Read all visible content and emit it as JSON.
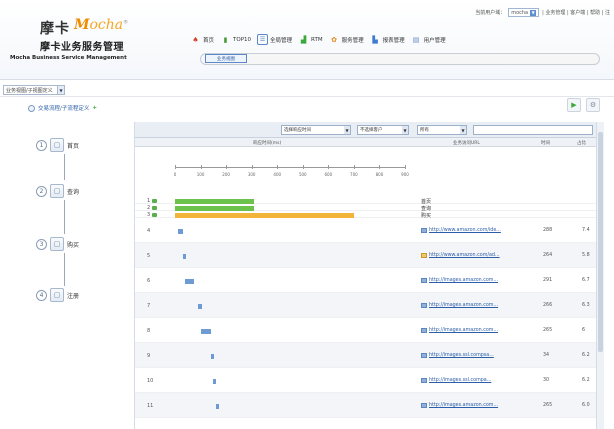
{
  "brand": {
    "name_cn": "摩卡",
    "name_en_first": "M",
    "name_en_rest": "ocha",
    "registered": "®",
    "product_cn": "摩卡业务服务管理",
    "product_en": "Mocha Business Service Management"
  },
  "toplinks": {
    "welcome": "当前用户域：",
    "user": "mocha",
    "links": "| 业务管理 | 客户端 | 帮助 | 注"
  },
  "nav": {
    "items": [
      {
        "label": "首页",
        "icon": "home-icon"
      },
      {
        "label": "TOP10",
        "icon": "top10-icon"
      },
      {
        "label": "全局管理",
        "icon": "global-icon"
      },
      {
        "label": "RTM",
        "icon": "rtm-icon"
      },
      {
        "label": "服务管理",
        "icon": "service-icon"
      },
      {
        "label": "报表管理",
        "icon": "report-icon"
      },
      {
        "label": "用户管理",
        "icon": "user-icon"
      }
    ],
    "active_tab": "业务视图"
  },
  "breadcrumb": {
    "select_value": "业务视图/子视图定义"
  },
  "subtitle": {
    "text": "交易流程/子流程定义",
    "plus": "+"
  },
  "flow": {
    "steps": [
      {
        "num": "1",
        "label": "首页"
      },
      {
        "num": "2",
        "label": "查询"
      },
      {
        "num": "3",
        "label": "购买"
      },
      {
        "num": "4",
        "label": "注册"
      }
    ]
  },
  "toolbar": {
    "select1": "选择响应时间",
    "select2": "不选择客户",
    "select3": "所有"
  },
  "columns": {
    "c1": "响应时间(ms)",
    "c2": "业务访问URL",
    "c3": "时间",
    "c4": "占比"
  },
  "axis": {
    "ticks": [
      "0",
      "100",
      "200",
      "300",
      "400",
      "500",
      "600",
      "700",
      "800",
      "900"
    ]
  },
  "rows": [
    {
      "num": "1",
      "label": "首页",
      "bar": {
        "type": "green",
        "start": 0,
        "end": 310
      }
    },
    {
      "num": "2",
      "label": "查询",
      "bar": {
        "type": "green",
        "start": 0,
        "end": 310
      }
    },
    {
      "num": "3",
      "label": "购买",
      "bar": {
        "type": "orange",
        "start": 0,
        "end": 700
      }
    },
    {
      "num": "4",
      "url": "http://www.amazon.com/ide...",
      "v1": "288",
      "v2": "7.4",
      "warn": false,
      "bar": {
        "type": "blue",
        "start": 10,
        "end": 30
      }
    },
    {
      "num": "5",
      "url": "http://www.amazon.com/ad...",
      "v1": "264",
      "v2": "5.8",
      "warn": true,
      "bar": {
        "type": "blue",
        "start": 30,
        "end": 45
      }
    },
    {
      "num": "6",
      "url": "http://images.amazon.com...",
      "v1": "291",
      "v2": "6.7",
      "warn": false,
      "bar": {
        "type": "blue",
        "start": 40,
        "end": 75
      }
    },
    {
      "num": "7",
      "url": "http://images.amazon.com...",
      "v1": "266",
      "v2": "6.3",
      "warn": false,
      "bar": {
        "type": "blue",
        "start": 90,
        "end": 105
      }
    },
    {
      "num": "8",
      "url": "http://images.amazon.com...",
      "v1": "265",
      "v2": "6",
      "warn": false,
      "bar": {
        "type": "blue",
        "start": 100,
        "end": 140
      }
    },
    {
      "num": "9",
      "url": "http://images.ssl.compsa...",
      "v1": "34",
      "v2": "6.2",
      "warn": false,
      "bar": {
        "type": "blue",
        "start": 140,
        "end": 145
      }
    },
    {
      "num": "10",
      "url": "http://images.ssl.compa...",
      "v1": "30",
      "v2": "6.2",
      "warn": false,
      "bar": {
        "type": "blue",
        "start": 150,
        "end": 155
      }
    },
    {
      "num": "11",
      "url": "http://images.amazon.com...",
      "v1": "265",
      "v2": "6.0",
      "warn": false,
      "bar": {
        "type": "blue",
        "start": 160,
        "end": 170
      }
    }
  ],
  "colors": {
    "accent": "#2b5ea8",
    "brand_orange": "#f08c00",
    "bar_green": "#6cc24a",
    "bar_orange": "#f3b43a",
    "bar_blue": "#6f9bd4"
  }
}
